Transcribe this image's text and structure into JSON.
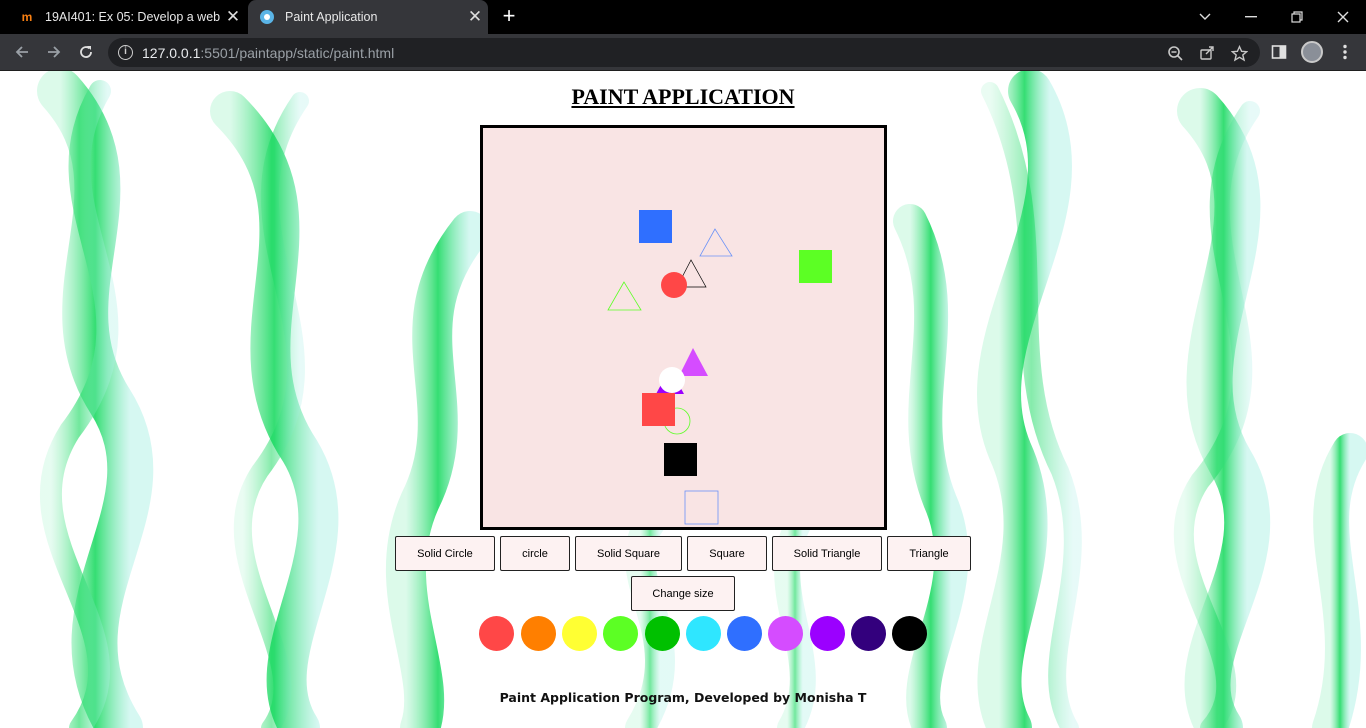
{
  "browser": {
    "tabs": [
      {
        "title": "19AI401: Ex 05: Develop a webpage",
        "favicon": "m"
      },
      {
        "title": "Paint Application",
        "favicon": "app-icon"
      }
    ],
    "url_host": "127.0.0.1",
    "url_rest": ":5501/paintapp/static/paint.html"
  },
  "page": {
    "title": "PAINT APPLICATION",
    "buttons": [
      "Solid Circle",
      "circle",
      "Solid Square",
      "Square",
      "Solid Triangle",
      "Triangle"
    ],
    "change_size": "Change size",
    "palette": [
      "#ffffff",
      "#ff4747",
      "#ff7f00",
      "#ffff33",
      "#5cff24",
      "#00c000",
      "#2fe6ff",
      "#2f6fff",
      "#d54cff",
      "#9b00ff",
      "#33007d",
      "#000000"
    ],
    "footer": "Paint Application Program, Developed by Monisha T"
  },
  "canvas": {
    "background": "#f9e4e4"
  }
}
